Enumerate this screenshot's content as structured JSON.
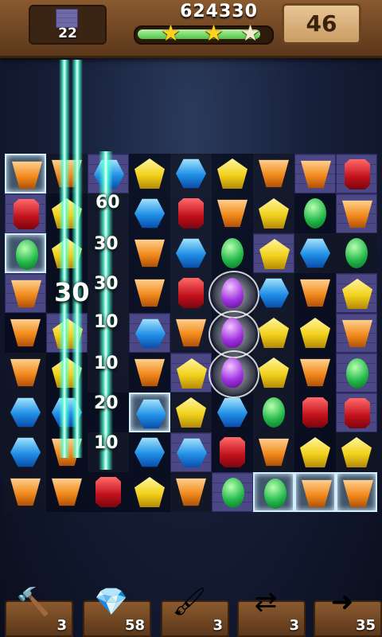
{
  "hud": {
    "goal_count": "22",
    "score": "624330",
    "moves": "46",
    "progress": 0.95,
    "stars": [
      {
        "icon": "star-icon",
        "earned": true
      },
      {
        "icon": "star-icon",
        "earned": true
      },
      {
        "icon": "star-icon",
        "earned": false
      }
    ]
  },
  "board": {
    "rows": 9,
    "cols": 9,
    "gems": [
      [
        "amber",
        "amber",
        "sapph",
        "topaz",
        "sapph",
        "topaz",
        "amber",
        "amber",
        "ruby"
      ],
      [
        "ruby",
        "topaz",
        "",
        "sapph",
        "ruby",
        "amber",
        "topaz",
        "emer",
        "amber"
      ],
      [
        "emer",
        "topaz",
        "",
        "amber",
        "sapph",
        "emer",
        "topaz",
        "sapph",
        "emer"
      ],
      [
        "amber",
        "",
        "",
        "amber",
        "ruby",
        "amy",
        "sapph",
        "amber",
        "topaz"
      ],
      [
        "amber",
        "topaz",
        "",
        "sapph",
        "amber",
        "amy",
        "topaz",
        "topaz",
        "amber"
      ],
      [
        "amber",
        "topaz",
        "",
        "amber",
        "topaz",
        "amy",
        "topaz",
        "amber",
        "emer"
      ],
      [
        "sapph",
        "sapph",
        "",
        "sapph",
        "topaz",
        "sapph",
        "emer",
        "ruby",
        "ruby"
      ],
      [
        "sapph",
        "amber",
        "",
        "sapph",
        "sapph",
        "ruby",
        "amber",
        "topaz",
        "topaz"
      ],
      [
        "amber",
        "amber",
        "ruby",
        "topaz",
        "amber",
        "emer",
        "emer",
        "amber",
        "amber"
      ]
    ],
    "tiles": [
      [
        "ice",
        "dk",
        "brick",
        "",
        "dk",
        "",
        "dk",
        "brick",
        "brick"
      ],
      [
        "brick",
        "",
        "dk",
        "",
        "dk",
        "",
        "dk",
        "",
        "brick"
      ],
      [
        "ice",
        "",
        "dk",
        "",
        "dk",
        "",
        "brick",
        "dk",
        "dk"
      ],
      [
        "brick",
        "",
        "dk",
        "",
        "dk",
        "",
        "dk",
        "",
        "brick"
      ],
      [
        "",
        "brick",
        "dk",
        "brick",
        "dk",
        "",
        "dk",
        "",
        "brick"
      ],
      [
        "dk",
        "",
        "dk",
        "",
        "brick",
        "",
        "dk",
        "",
        "brick"
      ],
      [
        "dk",
        "",
        "",
        "ice",
        "dk",
        "",
        "dk",
        "",
        "brick"
      ],
      [
        "dk",
        "",
        "dk",
        "",
        "brick",
        "",
        "dk",
        "",
        "dk"
      ],
      [
        "dk",
        "",
        "",
        "",
        "dk",
        "brick",
        "ice",
        "ice",
        "ice"
      ]
    ]
  },
  "popups": [
    {
      "text": "60",
      "size": "small"
    },
    {
      "text": "30",
      "size": "small"
    },
    {
      "text": "30",
      "size": "big"
    },
    {
      "text": "30",
      "size": "small"
    },
    {
      "text": "10",
      "size": "small"
    },
    {
      "text": "10",
      "size": "small"
    },
    {
      "text": "20",
      "size": "small"
    },
    {
      "text": "10",
      "size": "small"
    }
  ],
  "tools": [
    {
      "name": "hammer-booster",
      "icon": "hammer-icon",
      "glyph": "🔨",
      "count": "3"
    },
    {
      "name": "rainbow-gem-booster",
      "icon": "rainbow-gem-icon",
      "glyph": "💎",
      "count": "58"
    },
    {
      "name": "brush-booster",
      "icon": "brush-icon",
      "glyph": "🖌",
      "count": "3"
    },
    {
      "name": "swap-booster",
      "icon": "swap-arrows-icon",
      "glyph": "⇄",
      "count": "3"
    },
    {
      "name": "extra-moves-booster",
      "icon": "plus-five-moves-icon",
      "glyph": "➜",
      "count": "35"
    }
  ]
}
